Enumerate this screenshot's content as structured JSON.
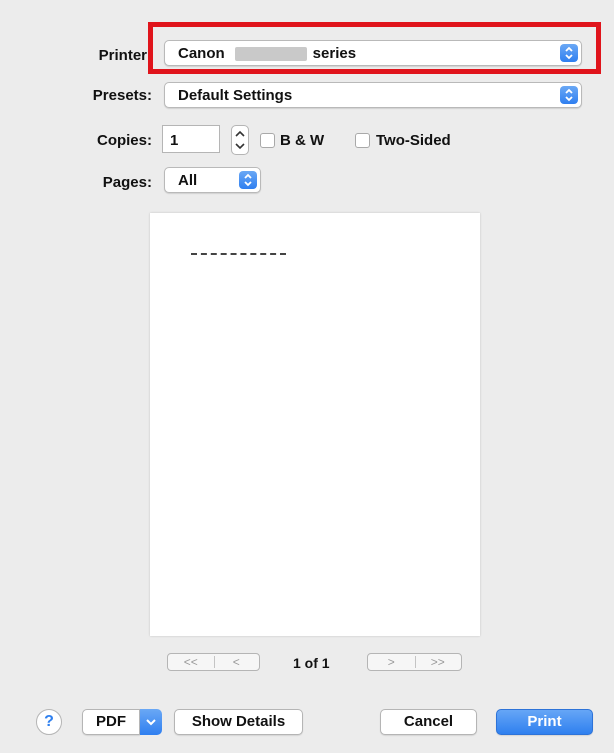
{
  "printer": {
    "label": "Printer:",
    "value_prefix": "Canon",
    "value_suffix": "series"
  },
  "presets": {
    "label": "Presets:",
    "value": "Default Settings"
  },
  "copies": {
    "label": "Copies:",
    "value": "1"
  },
  "checkboxes": {
    "bw": "B & W",
    "two_sided": "Two-Sided"
  },
  "pages": {
    "label": "Pages:",
    "value": "All"
  },
  "pager": {
    "first": "<<",
    "prev": "<",
    "next": ">",
    "last": ">>",
    "status": "1 of 1"
  },
  "buttons": {
    "help": "?",
    "pdf": "PDF",
    "show_details": "Show Details",
    "cancel": "Cancel",
    "print": "Print"
  },
  "colors": {
    "accent": "#2f80ef",
    "highlight": "#e0141b"
  }
}
